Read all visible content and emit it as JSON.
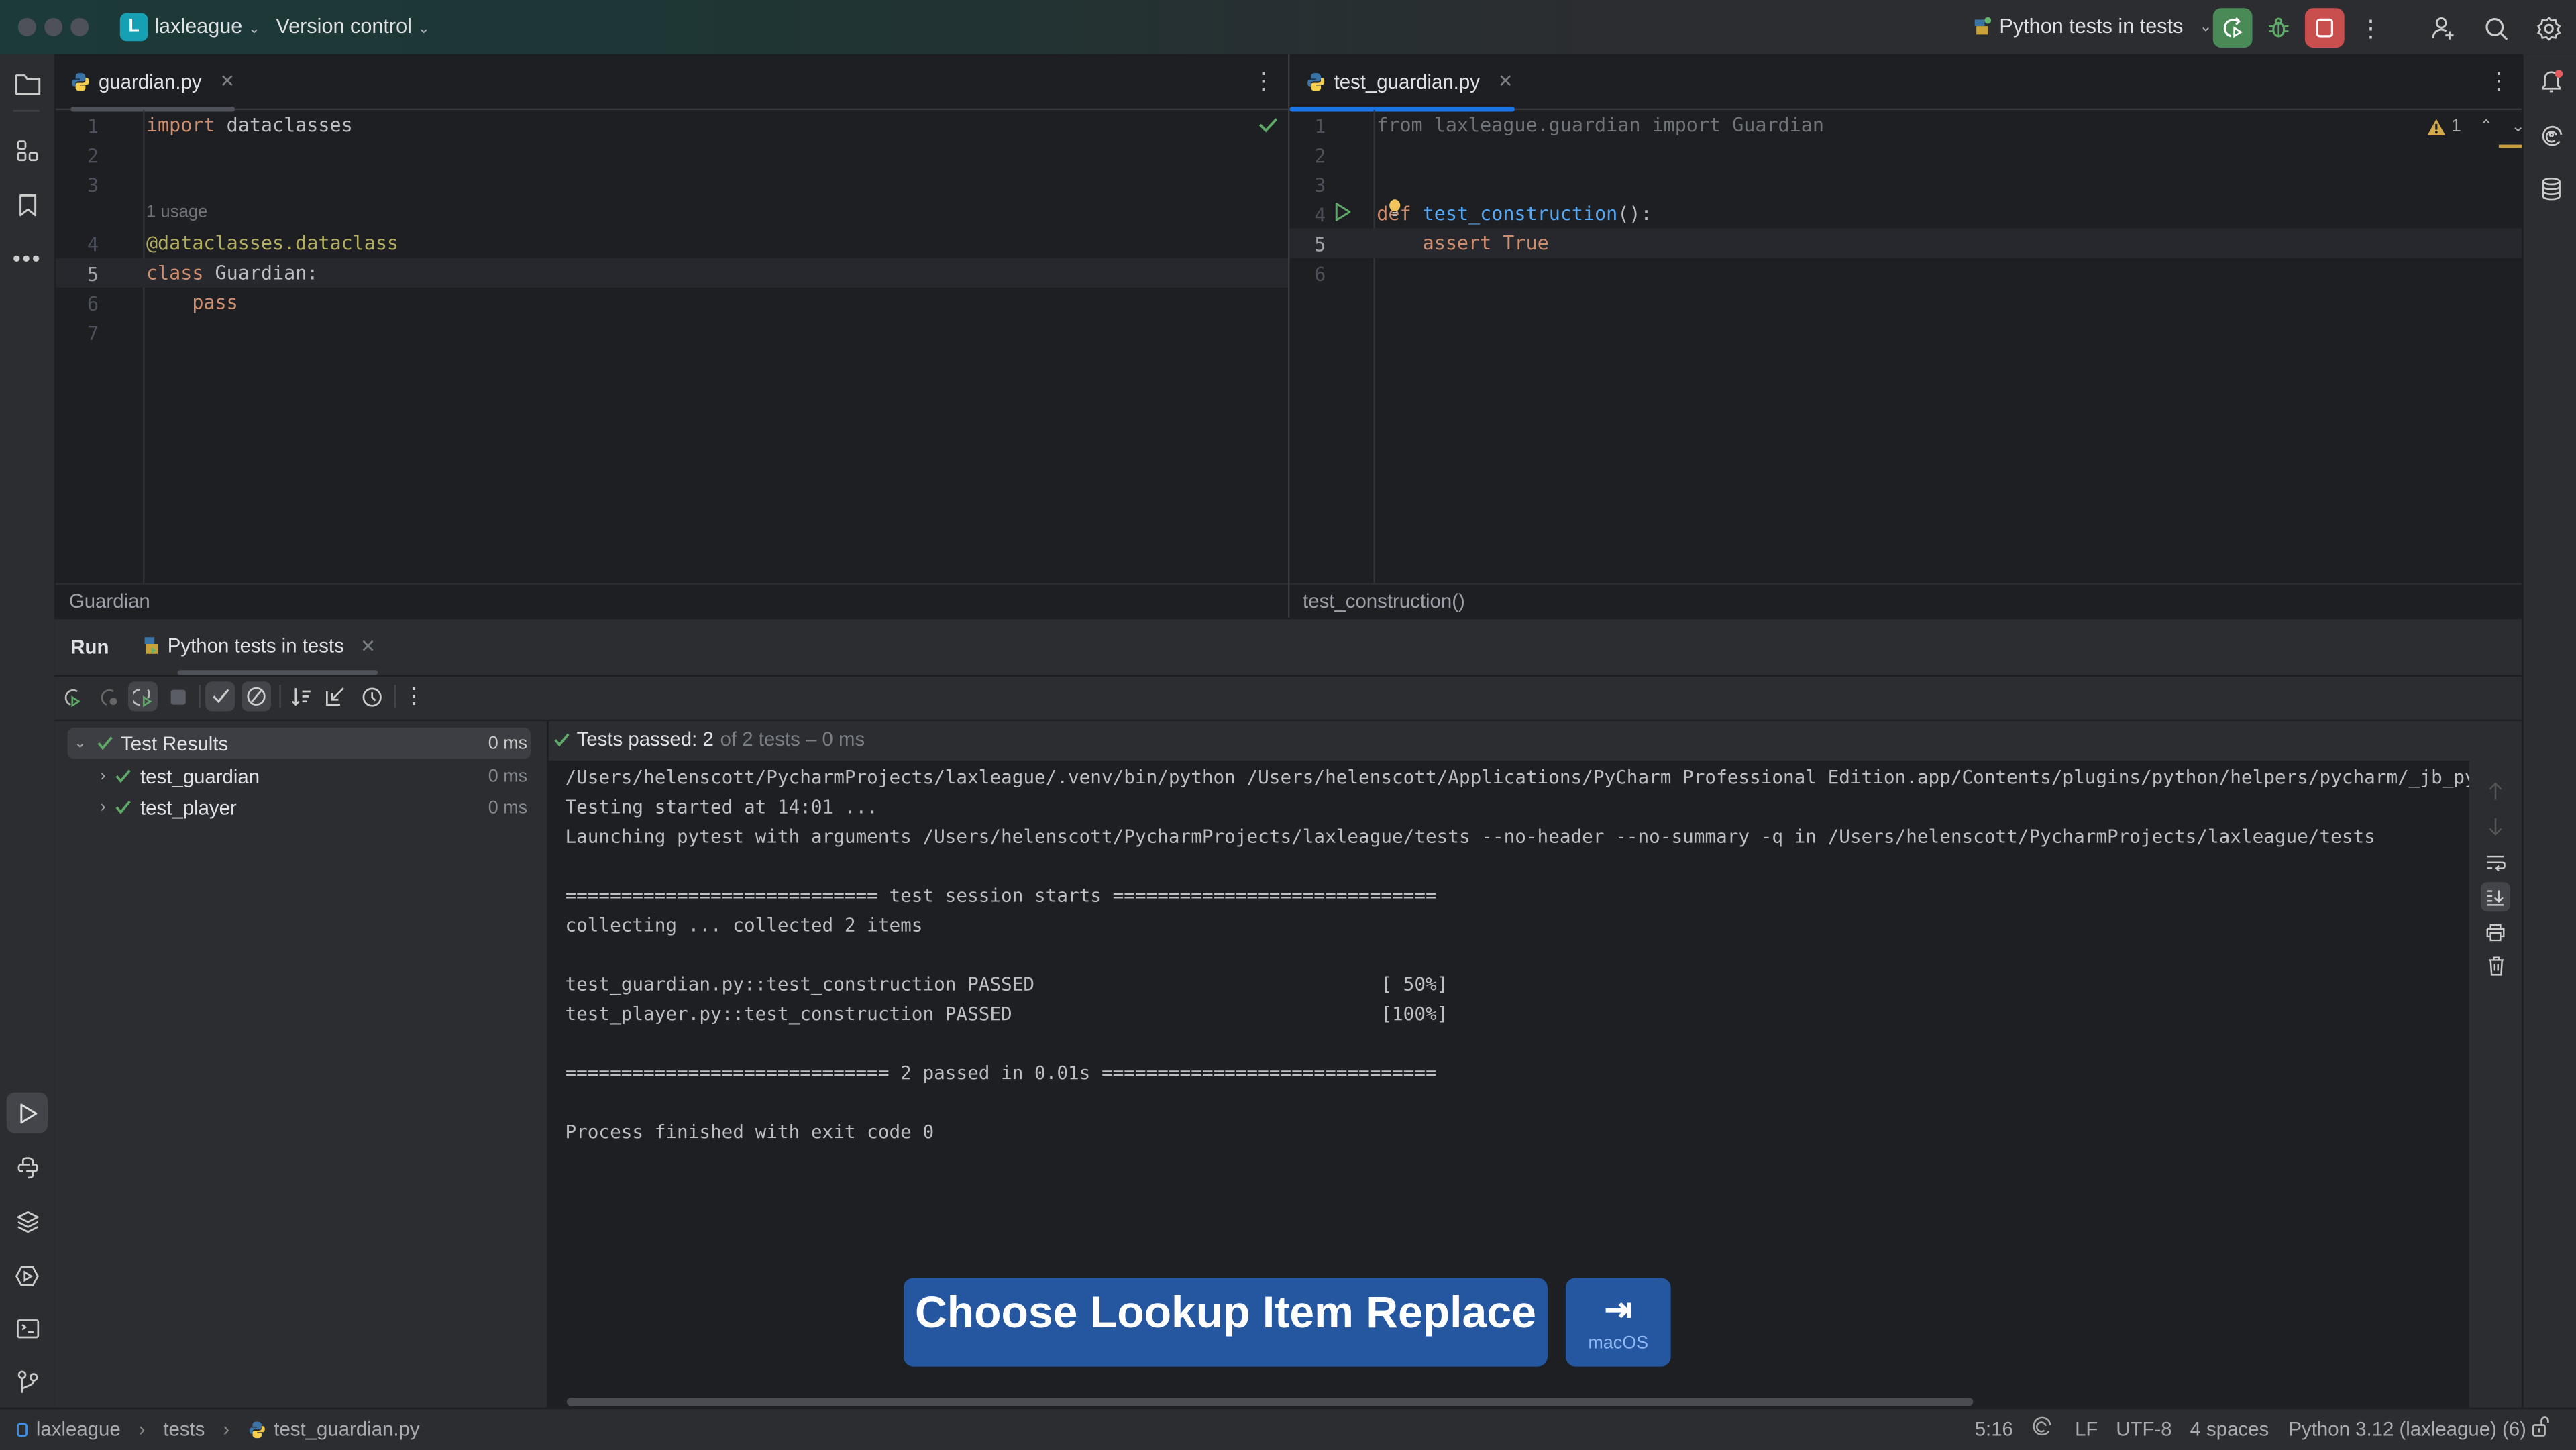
{
  "titlebar": {
    "project_initial": "L",
    "project_name": "laxleague",
    "vcs_label": "Version control",
    "run_config": "Python tests in tests",
    "colors": {
      "rerun_bg": "#4a8a56",
      "stop_bg": "#c94f4f",
      "debug": "#5fa968"
    }
  },
  "left_toolbar": {
    "top": [
      "folder-icon",
      "structure-icon",
      "bookmark-icon",
      "more-icon"
    ],
    "bottom": [
      "run-icon",
      "python-console-icon",
      "layers-icon",
      "services-icon",
      "terminal-icon",
      "git-icon"
    ]
  },
  "right_toolbar": [
    "notifications-icon",
    "ai-assistant-icon",
    "database-icon"
  ],
  "editor_left": {
    "tab_label": "guardian.py",
    "breadcrumb": "Guardian",
    "usage_hint": "1 usage",
    "lines": [
      {
        "n": "1",
        "tokens": [
          {
            "t": "import",
            "c": "kw"
          },
          {
            "t": " dataclasses",
            "c": ""
          }
        ]
      },
      {
        "n": "2",
        "tokens": []
      },
      {
        "n": "3",
        "tokens": []
      },
      {
        "n": "4",
        "tokens": [
          {
            "t": "@dataclasses.dataclass",
            "c": "dec"
          }
        ]
      },
      {
        "n": "5",
        "tokens": [
          {
            "t": "class",
            "c": "kw"
          },
          {
            "t": " Guardian:",
            "c": ""
          }
        ]
      },
      {
        "n": "6",
        "tokens": [
          {
            "t": "    pass",
            "c": "kw"
          }
        ]
      },
      {
        "n": "7",
        "tokens": []
      }
    ]
  },
  "editor_right": {
    "tab_label": "test_guardian.py",
    "breadcrumb": "test_construction()",
    "warning_count": "1",
    "lines": [
      {
        "n": "1",
        "tokens": [
          {
            "t": "from laxleague.guardian import Guardian",
            "c": "dim"
          }
        ]
      },
      {
        "n": "2",
        "tokens": []
      },
      {
        "n": "3",
        "tokens": []
      },
      {
        "n": "4",
        "tokens": [
          {
            "t": "def",
            "c": "kw"
          },
          {
            "t": " ",
            "c": ""
          },
          {
            "t": "test_construction",
            "c": "fn"
          },
          {
            "t": "():",
            "c": ""
          }
        ]
      },
      {
        "n": "5",
        "tokens": [
          {
            "t": "    assert True",
            "c": "kw"
          }
        ]
      },
      {
        "n": "6",
        "tokens": []
      }
    ]
  },
  "run_panel": {
    "title": "Run",
    "tab_label": "Python tests in tests",
    "summary_main": "Tests passed: 2",
    "summary_rest": " of 2 tests – 0 ms",
    "tree": [
      {
        "label": "Test Results",
        "time": "0 ms"
      },
      {
        "label": "test_guardian",
        "time": "0 ms"
      },
      {
        "label": "test_player",
        "time": "0 ms"
      }
    ],
    "console": [
      "/Users/helenscott/PycharmProjects/laxleague/.venv/bin/python /Users/helenscott/Applications/PyCharm Professional Edition.app/Contents/plugins/python/helpers/pycharm/_jb_pytest_runner",
      "Testing started at 14:01 ...",
      "Launching pytest with arguments /Users/helenscott/PycharmProjects/laxleague/tests --no-header --no-summary -q in /Users/helenscott/PycharmProjects/laxleague/tests",
      "",
      "============================ test session starts =============================",
      "collecting ... collected 2 items",
      "",
      "test_guardian.py::test_construction PASSED                               [ 50%]",
      "test_player.py::test_construction PASSED                                 [100%]",
      "",
      "============================= 2 passed in 0.01s ==============================",
      "",
      "Process finished with exit code 0"
    ]
  },
  "shortcut_overlay": {
    "action": "Choose Lookup Item Replace",
    "key_symbol": "⇥",
    "platform": "macOS"
  },
  "statusbar": {
    "breadcrumbs": [
      "laxleague",
      "tests",
      "test_guardian.py"
    ],
    "position": "5:16",
    "line_ending": "LF",
    "encoding": "UTF-8",
    "indent": "4 spaces",
    "interpreter": "Python 3.12 (laxleague) (6)"
  }
}
